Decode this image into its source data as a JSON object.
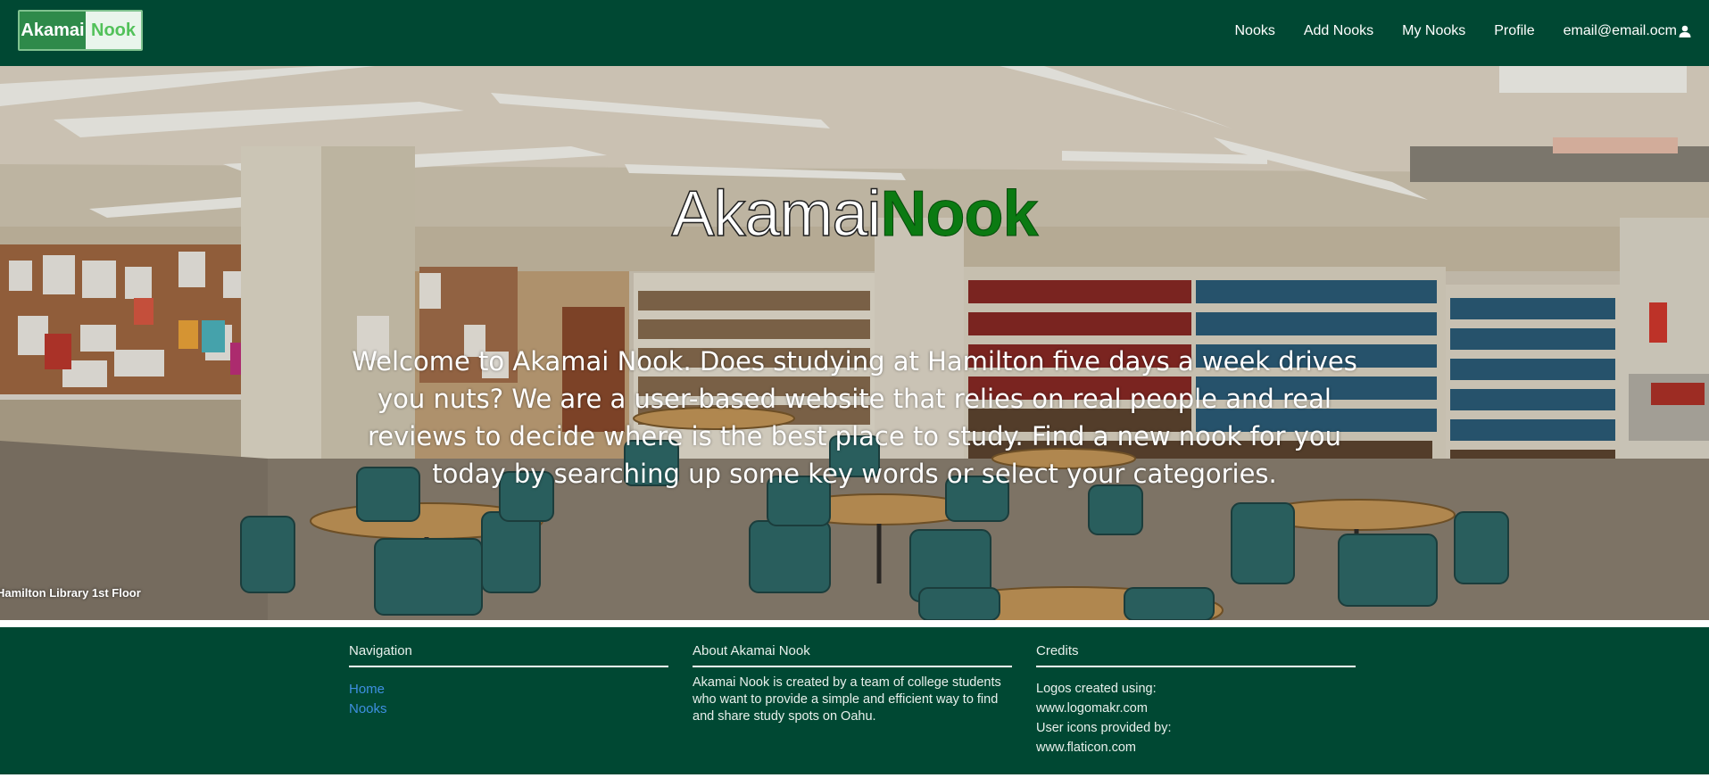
{
  "brand": {
    "logo_part1": "Akamai",
    "logo_part2": "Nook",
    "color_dark_green": "#004833",
    "color_accent_green": "#0b7a12"
  },
  "nav": {
    "items": [
      {
        "label": "Nooks"
      },
      {
        "label": "Add Nooks"
      },
      {
        "label": "My Nooks"
      },
      {
        "label": "Profile"
      }
    ],
    "user_email": "email@email.ocm",
    "user_icon": "user-icon"
  },
  "hero": {
    "title_part1": "Akamai",
    "title_part2": "Nook",
    "description": "Welcome to Akamai Nook. Does studying at Hamilton five days a week drives you nuts? We are a user-based website that relies on real people and real reviews to decide where is the best place to study. Find a new nook for you today by searching up some key words or select your categories.",
    "caption": "Hamilton Library 1st Floor"
  },
  "footer": {
    "navigation": {
      "heading": "Navigation",
      "links": [
        {
          "label": "Home"
        },
        {
          "label": "Nooks"
        }
      ],
      "link_color": "#3e8fe0"
    },
    "about": {
      "heading": "About Akamai Nook",
      "text": "Akamai Nook is created by a team of college students who want to provide a simple and efficient way to find and share study spots on Oahu."
    },
    "credits": {
      "heading": "Credits",
      "lines": [
        "Logos created using:",
        "www.logomakr.com",
        "User icons provided by:",
        "www.flaticon.com"
      ]
    }
  }
}
